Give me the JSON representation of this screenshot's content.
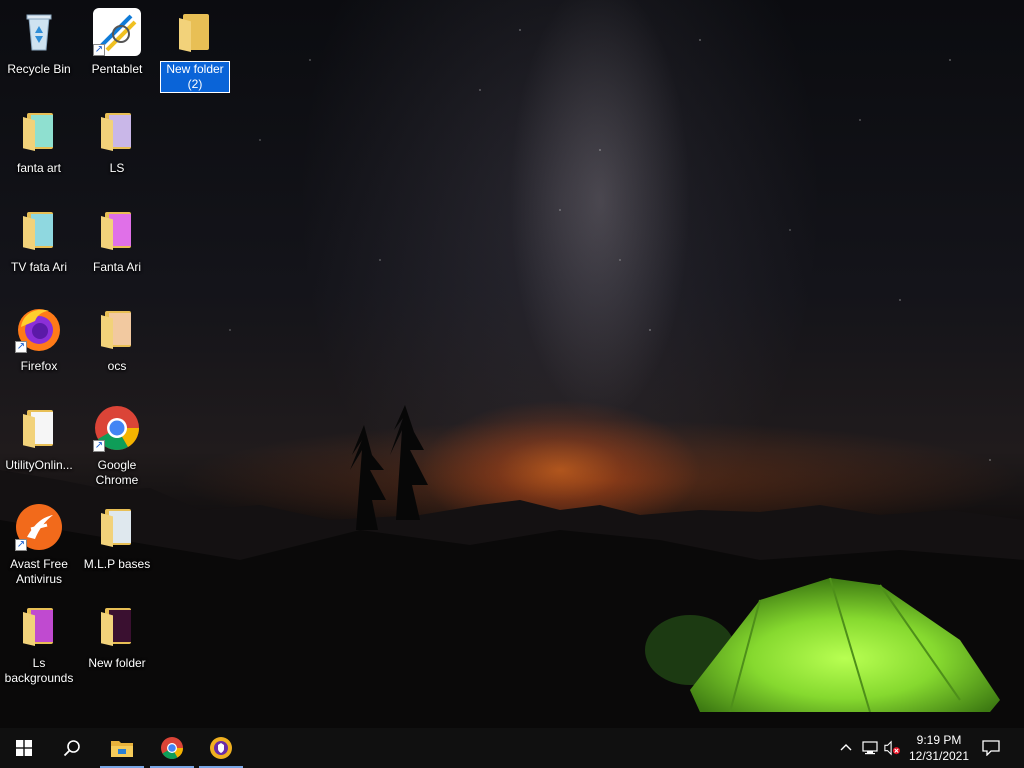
{
  "desktop_icons": [
    {
      "id": "recycle",
      "label": "Recycle Bin",
      "icon": "recycle-bin-icon"
    },
    {
      "id": "pentablet",
      "label": "Pentablet",
      "icon": "pentablet-icon",
      "shortcut": true
    },
    {
      "id": "newfolder2",
      "label": "New folder (2)",
      "icon": "folder-icon",
      "selected": true
    },
    {
      "id": "fantaart",
      "label": "fanta art",
      "icon": "folder-icon"
    },
    {
      "id": "ls",
      "label": "LS",
      "icon": "folder-icon"
    },
    {
      "id": "tvfata",
      "label": "TV  fata Ari",
      "icon": "folder-icon"
    },
    {
      "id": "fantaari",
      "label": "Fanta Ari",
      "icon": "folder-icon"
    },
    {
      "id": "firefox",
      "label": "Firefox",
      "icon": "firefox-icon",
      "shortcut": true
    },
    {
      "id": "ocs",
      "label": "ocs",
      "icon": "folder-icon"
    },
    {
      "id": "utility",
      "label": "UtilityOnlin...",
      "icon": "folder-icon"
    },
    {
      "id": "chrome",
      "label": "Google Chrome",
      "icon": "chrome-icon",
      "shortcut": true
    },
    {
      "id": "avast",
      "label": "Avast Free Antivirus",
      "icon": "avast-icon",
      "shortcut": true
    },
    {
      "id": "mlp",
      "label": "M.L.P bases",
      "icon": "folder-icon"
    },
    {
      "id": "lsbg",
      "label": "Ls backgrounds",
      "icon": "folder-icon"
    },
    {
      "id": "newfolder",
      "label": "New folder",
      "icon": "folder-icon"
    }
  ],
  "taskbar": {
    "start_icon": "windows-start-icon",
    "search_icon": "search-icon",
    "pinned": [
      {
        "name": "file-explorer",
        "icon": "file-explorer-icon",
        "active": true
      },
      {
        "name": "google-chrome",
        "icon": "chrome-icon",
        "active": true
      },
      {
        "name": "avast-secure-browser",
        "icon": "avast-browser-icon",
        "active": true
      }
    ],
    "tray": {
      "show_hidden_icon": "chevron-up-icon",
      "network_icon": "network-icon",
      "volume_icon": "volume-muted-icon",
      "notifications_icon": "action-center-icon"
    },
    "clock": {
      "time": "9:19 PM",
      "date": "12/31/2021"
    }
  },
  "colors": {
    "taskbar": "#101010",
    "selection": "#0a64d8",
    "folder": "#e8bf55",
    "tent": "#8ee03a"
  }
}
